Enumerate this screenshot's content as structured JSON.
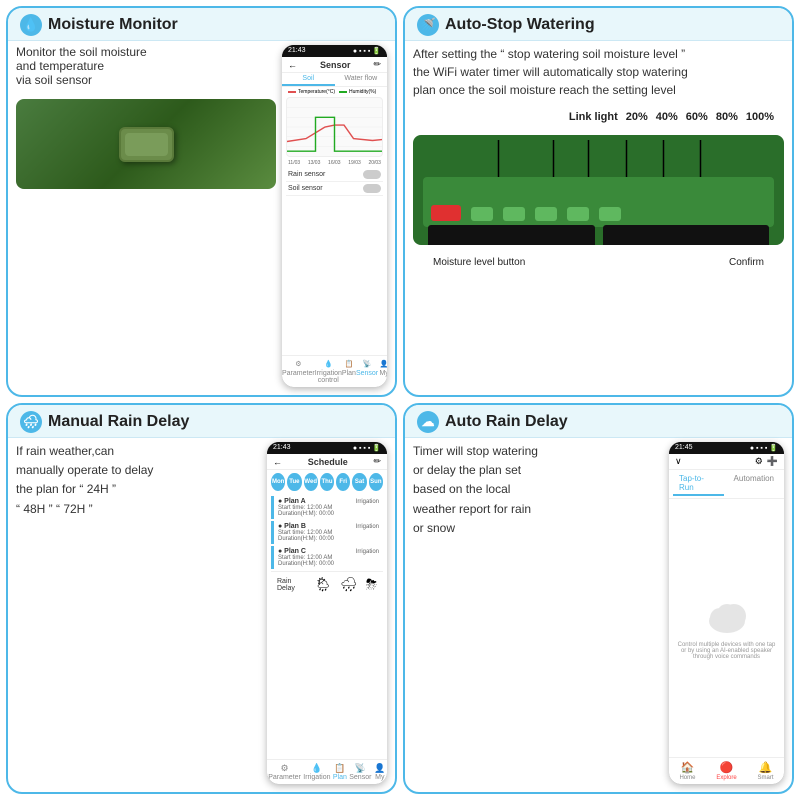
{
  "cards": {
    "moisture": {
      "title": "Moisture Monitor",
      "icon": "💧",
      "description_line1": "Monitor the soil moisture",
      "description_line2": "and temperature",
      "description_line3": "via soil sensor",
      "phone": {
        "time": "21:43",
        "signal": "▲ ▪ ▪ ▪",
        "title": "Sensor",
        "tabs": [
          "Soil",
          "Water flow"
        ],
        "active_tab": "Soil",
        "legend": [
          {
            "label": "Temperature(°C)",
            "color": "#e05050"
          },
          {
            "label": "Humidity(%)",
            "color": "#22aa22"
          }
        ],
        "x_labels": [
          "11/03",
          "13/03",
          "16/03",
          "19/03",
          "20/03"
        ],
        "sensors": [
          {
            "name": "Rain sensor"
          },
          {
            "name": "Soil sensor"
          }
        ],
        "bottom_items": [
          "Parameter",
          "Irrigation control",
          "Plan",
          "Sensor",
          "My"
        ],
        "active_bottom": "Sensor"
      }
    },
    "autostop": {
      "title": "Auto-Stop Watering",
      "icon": "🚿",
      "description_line1": "After setting the “ stop watering soil moisture level ”",
      "description_line2": "the WiFi water timer will automatically stop watering",
      "description_line3": "plan once the soil moisture reach the setting level",
      "link_light_label": "Link light",
      "percentages": [
        "20%",
        "40%",
        "60%",
        "80%",
        "100%"
      ],
      "moisture_button_label": "Moisture level button",
      "confirm_label": "Confirm"
    },
    "manual": {
      "title": "Manual Rain Delay",
      "icon": "🌧",
      "description_line1": "If rain weather,can",
      "description_line2": "manually operate to delay",
      "description_line3": "the plan for “ 24H ”",
      "description_line4": "“ 48H ” “ 72H ”",
      "phone": {
        "time": "21:43",
        "signal": "▲ ▪ ▪ ▪",
        "title": "Schedule",
        "days": [
          "Mon",
          "Tue",
          "Wed",
          "Thu",
          "Fri",
          "Sat",
          "Sun"
        ],
        "active_days": [
          0,
          1,
          2,
          3,
          4,
          5,
          6
        ],
        "plans": [
          {
            "name": "Plan A",
            "type": "Irrigation",
            "time": "Start time: 12:00 AM",
            "duration": "Duration(H:M): 00:00"
          },
          {
            "name": "Plan B",
            "type": "Irrigation",
            "time": "Start time: 12:00 AM",
            "duration": "Duration(H:M): 00:00"
          },
          {
            "name": "Plan C",
            "type": "Irrigation",
            "time": "Start time: 12:00 AM",
            "duration": "Duration(H:M): 00:00"
          }
        ],
        "rain_delay_label": "Rain Delay",
        "bottom_items": [
          "Parameter",
          "Irrigation control",
          "Plan",
          "Sensor",
          "My"
        ],
        "active_bottom": "Plan"
      }
    },
    "autorain": {
      "title": "Auto Rain Delay",
      "icon": "☁",
      "description_line1": "Timer will stop watering",
      "description_line2": "or delay the plan set",
      "description_line3": "based on the local",
      "description_line4": "weather report for rain",
      "description_line5": "or snow",
      "phone": {
        "time": "21:45",
        "signal": "▲ ▪ ▪ ▪",
        "tabs": [
          "Tap-to-Run",
          "Automation"
        ],
        "active_tab": "Tap-to-Run",
        "cloud_desc": "Control multiple devices with one tap or by using an AI-enabled speaker through voice commands",
        "bottom_items": [
          "Home",
          "Explore",
          "Smart"
        ],
        "active_bottom": "Explore"
      }
    }
  }
}
